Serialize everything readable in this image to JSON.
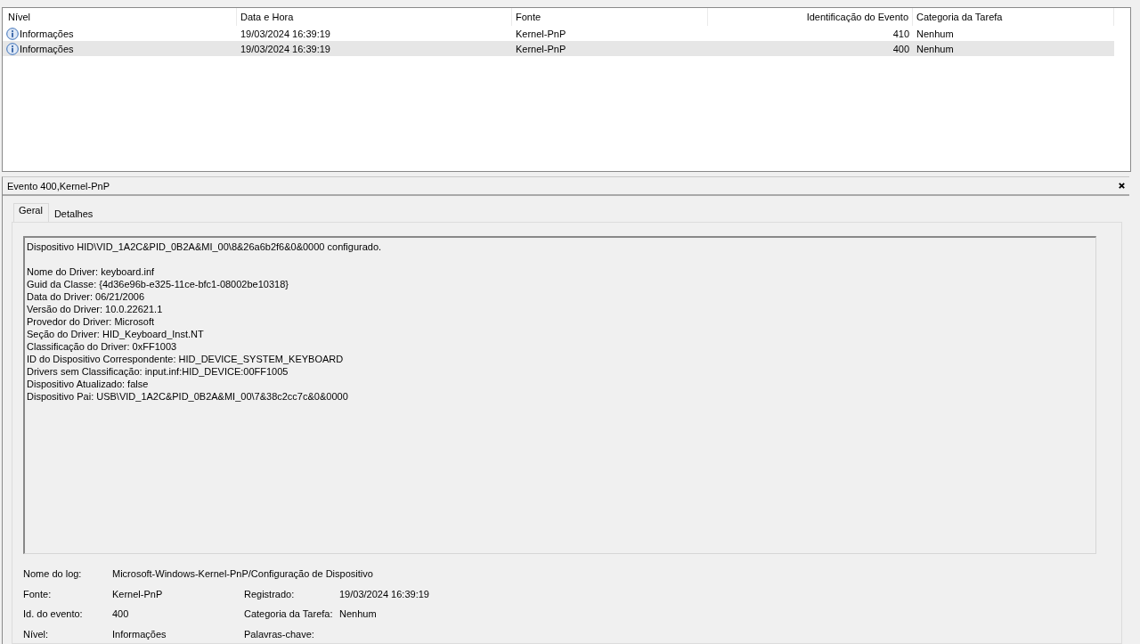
{
  "events_table": {
    "columns": [
      "Nível",
      "Data e Hora",
      "Fonte",
      "Identificação do Evento",
      "Categoria da Tarefa"
    ],
    "rows": [
      {
        "level": "Informações",
        "date": "19/03/2024 16:39:19",
        "source": "Kernel-PnP",
        "event_id": "410",
        "category": "Nenhum",
        "selected": false
      },
      {
        "level": "Informações",
        "date": "19/03/2024 16:39:19",
        "source": "Kernel-PnP",
        "event_id": "400",
        "category": "Nenhum",
        "selected": true
      }
    ]
  },
  "details": {
    "title": "Evento 400,Kernel-PnP",
    "tabs": [
      {
        "label": "Geral",
        "selected": true
      },
      {
        "label": "Detalhes",
        "selected": false
      }
    ],
    "summary": "Dispositivo HID\\VID_1A2C&PID_0B2A&MI_00\\8&26a6b2f6&0&0000 configurado.",
    "lines": [
      "Nome do Driver: keyboard.inf",
      "Guid da Classe: {4d36e96b-e325-11ce-bfc1-08002be10318}",
      "Data do Driver: 06/21/2006",
      "Versão do Driver: 10.0.22621.1",
      "Provedor do Driver: Microsoft",
      "Seção do Driver: HID_Keyboard_Inst.NT",
      "Classificação do Driver: 0xFF1003",
      "ID do Dispositivo Correspondente: HID_DEVICE_SYSTEM_KEYBOARD",
      "Drivers sem Classificação: input.inf:HID_DEVICE:00FF1005",
      "Dispositivo Atualizado: false",
      "Dispositivo Pai: USB\\VID_1A2C&PID_0B2A&MI_00\\7&38c2cc7c&0&0000"
    ],
    "log_name": {
      "label": "Nome do log:",
      "value": "Microsoft-Windows-Kernel-PnP/Configuração de Dispositivo"
    },
    "fields": [
      {
        "label": "Fonte:",
        "value": "Kernel-PnP",
        "label2": "Registrado:",
        "value2": "19/03/2024 16:39:19"
      },
      {
        "label": "Id. do evento:",
        "value": "400",
        "label2": "Categoria da Tarefa:",
        "value2": "Nenhum"
      },
      {
        "label": "Nível:",
        "value": "Informações",
        "label2": "Palavras-chave:"
      }
    ]
  }
}
